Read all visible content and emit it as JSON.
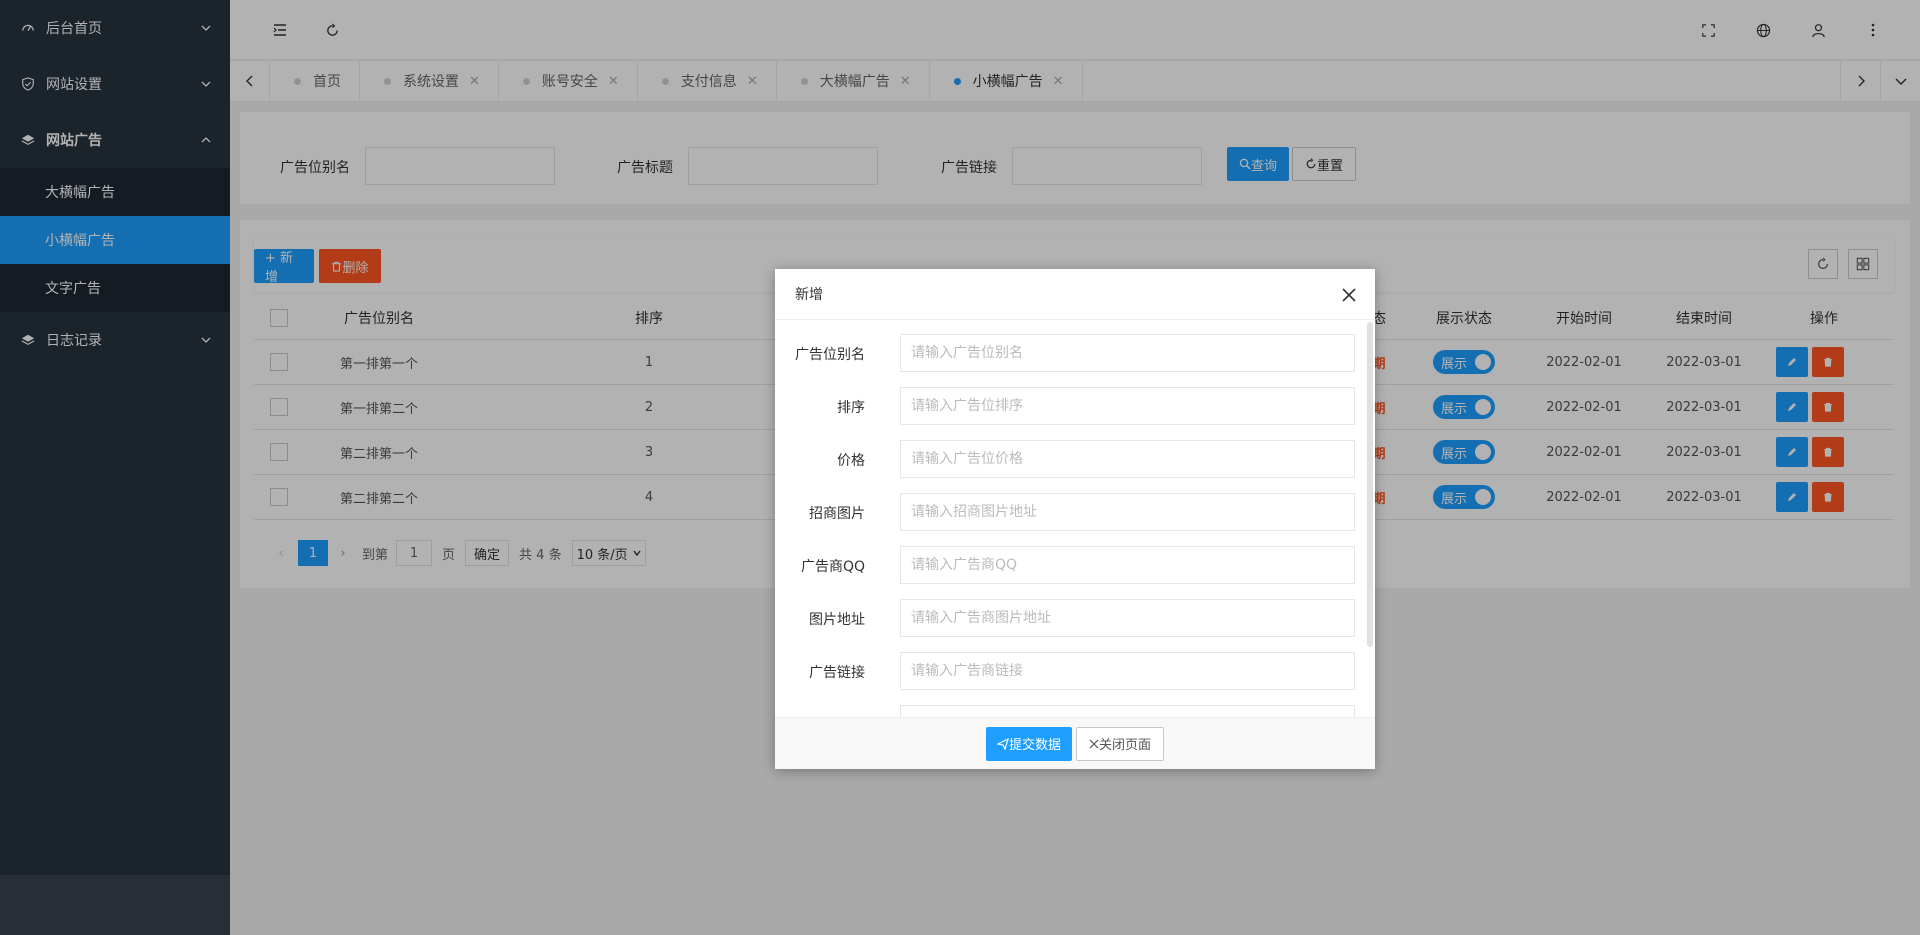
{
  "sidebar": {
    "items": [
      {
        "label": "后台首页",
        "icon": "dashboard-icon"
      },
      {
        "label": "网站设置",
        "icon": "shield-icon"
      },
      {
        "label": "网站广告",
        "icon": "layers-icon",
        "open": true,
        "children": [
          {
            "label": "大横幅广告"
          },
          {
            "label": "小横幅广告",
            "active": true
          },
          {
            "label": "文字广告"
          }
        ]
      },
      {
        "label": "日志记录",
        "icon": "layers-icon"
      }
    ]
  },
  "tabs": [
    {
      "label": "首页"
    },
    {
      "label": "系统设置"
    },
    {
      "label": "账号安全"
    },
    {
      "label": "支付信息"
    },
    {
      "label": "大横幅广告"
    },
    {
      "label": "小横幅广告",
      "active": true
    }
  ],
  "search": {
    "fields": [
      {
        "label": "广告位别名"
      },
      {
        "label": "广告标题"
      },
      {
        "label": "广告链接"
      }
    ],
    "query_label": "查询",
    "reset_label": "重置"
  },
  "toolbar": {
    "add_label": "+ 新增",
    "delete_label": "删除"
  },
  "table": {
    "headers": {
      "alias": "广告位别名",
      "sort": "排序",
      "status_partial": "态",
      "display": "展示状态",
      "start": "开始时间",
      "end": "结束时间",
      "ops": "操作"
    },
    "rows": [
      {
        "alias": "第一排第一个",
        "sort": "1",
        "status": "期",
        "display": "展示",
        "start": "2022-02-01",
        "end": "2022-03-01"
      },
      {
        "alias": "第一排第二个",
        "sort": "2",
        "status": "期",
        "display": "展示",
        "start": "2022-02-01",
        "end": "2022-03-01"
      },
      {
        "alias": "第二排第一个",
        "sort": "3",
        "status": "期",
        "display": "展示",
        "start": "2022-02-01",
        "end": "2022-03-01"
      },
      {
        "alias": "第二排第二个",
        "sort": "4",
        "status": "期",
        "display": "展示",
        "start": "2022-02-01",
        "end": "2022-03-01"
      }
    ]
  },
  "pager": {
    "current": "1",
    "goto_label": "到第",
    "goto_value": "1",
    "page_unit": "页",
    "confirm_label": "确定",
    "total_label": "共 4 条",
    "size_label": "10 条/页"
  },
  "modal": {
    "title": "新增",
    "fields": [
      {
        "label": "广告位别名",
        "placeholder": "请输入广告位别名"
      },
      {
        "label": "排序",
        "placeholder": "请输入广告位排序"
      },
      {
        "label": "价格",
        "placeholder": "请输入广告位价格"
      },
      {
        "label": "招商图片",
        "placeholder": "请输入招商图片地址"
      },
      {
        "label": "广告商QQ",
        "placeholder": "请输入广告商QQ"
      },
      {
        "label": "图片地址",
        "placeholder": "请输入广告商图片地址"
      },
      {
        "label": "广告链接",
        "placeholder": "请输入广告商链接"
      }
    ],
    "submit_label": "提交数据",
    "close_label": "关闭页面"
  },
  "colors": {
    "sidebar_bg": "#28333e",
    "accent": "#1e9fff",
    "danger": "#ff5722"
  }
}
